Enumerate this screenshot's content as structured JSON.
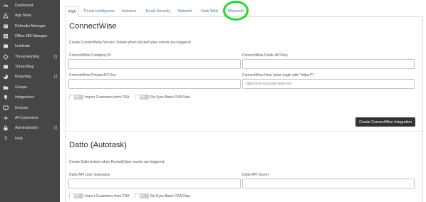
{
  "sidebar": {
    "items": [
      {
        "label": "Dashboard",
        "icon": "dashboard-icon"
      },
      {
        "label": "App Store",
        "icon": "app-store-icon"
      },
      {
        "label": "Defender Manager",
        "icon": "defender-icon"
      },
      {
        "label": "Office 365 Manager",
        "icon": "office365-icon"
      },
      {
        "label": "Incidents",
        "icon": "incidents-icon"
      },
      {
        "label": "Threat Hunting",
        "icon": "threat-hunting-icon"
      },
      {
        "label": "Threat Map",
        "icon": "map-icon"
      },
      {
        "label": "Reporting",
        "icon": "reporting-icon"
      },
      {
        "label": "Groups",
        "icon": "folder-icon"
      },
      {
        "label": "Integrations",
        "icon": "integrations-icon"
      },
      {
        "label": "Devices",
        "icon": "monitor-icon"
      },
      {
        "label": "All Customers",
        "icon": "customers-icon"
      },
      {
        "label": "Administration",
        "icon": "lock-icon"
      },
      {
        "label": "Help",
        "icon": "help-icon"
      }
    ]
  },
  "tabs": [
    "PSA",
    "Threat Intelligence",
    "Antivirus",
    "Email Security",
    "Network",
    "Dark Web",
    "Microsoft"
  ],
  "active_tab": "PSA",
  "highlight_color": "#1fdb2b",
  "connectwise": {
    "title": "ConnectWise",
    "description": "Create ConnectWise Service Tickets when RocketCyber events are triggered",
    "company_id_label": "ConnectWise Company ID",
    "company_id_value": "",
    "public_key_label": "ConnectWise Public API Key",
    "public_key_value": "",
    "private_key_label": "ConnectWise Private API Key",
    "private_key_value": "",
    "host_label": "ConnectWise Host (must begin with \"https://\")",
    "host_placeholder": "https://na.myconnectwise.net",
    "toggle_import_state": "NO",
    "toggle_import_label": "Import Customers from PSA",
    "toggle_resync_state": "NO",
    "toggle_resync_label": "Re-Sync Basic PSA Data",
    "create_button": "Create ConnectWise Integration"
  },
  "datto": {
    "title": "Datto (Autotask)",
    "description": "Create Datto tickets when RocketCyber events are triggered.",
    "username_label": "Datto API User Username",
    "username_value": "",
    "secret_label": "Datto API Secret",
    "secret_value": "",
    "toggle_import_state": "NO",
    "toggle_import_label": "Import Customers from PSA",
    "toggle_resync_state": "NO",
    "toggle_resync_label": "Re-Sync Basic PSA Data"
  }
}
